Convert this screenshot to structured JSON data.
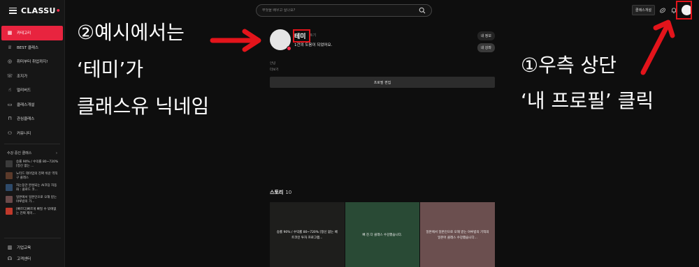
{
  "sidebar": {
    "logo": "CLASSU",
    "logo_dot": "•",
    "nav": [
      {
        "label": "카테고리",
        "icon": "category-icon"
      },
      {
        "label": "BEST 클래스",
        "icon": "trophy-icon"
      },
      {
        "label": "취미부터 취업까지!",
        "icon": "target-icon"
      },
      {
        "label": "조지가",
        "icon": "phone-icon"
      },
      {
        "label": "얼리버드",
        "icon": "thumbs-up-icon"
      },
      {
        "label": "클래스개설",
        "icon": "video-icon"
      },
      {
        "label": "관심클래스",
        "icon": "bookmark-icon"
      },
      {
        "label": "커뮤니티",
        "icon": "people-icon"
      }
    ],
    "section_title": "수강 중인 클래스",
    "section_chevron": "›",
    "courses": [
      {
        "title": "승률 90% / 수익률 80~720% [정신 없는 ...",
        "color": "#3a3a3a"
      },
      {
        "title": "노터드 데이엄의 진짜 쉬운 역직구 클래스",
        "color": "#5b3a2a"
      },
      {
        "title": "자는동안 완성되는 AI코딩 자동화 : 클로드 코...",
        "color": "#2e4a6a"
      },
      {
        "title": "일본에서 일본인으로 오해 받는 야루밤의 가...",
        "color": "#6a4a4a"
      },
      {
        "title": "[빠르디]빠르게 빠질 수 밖에없는 진짜 제미...",
        "color": "#c0392b"
      }
    ],
    "footer": [
      {
        "label": "기업교육",
        "icon": "building-icon"
      },
      {
        "label": "고객센터",
        "icon": "headset-icon"
      }
    ]
  },
  "header": {
    "search_placeholder": "무엇을 배우고 싶나요?",
    "open_class_label": "클래스개설"
  },
  "profile": {
    "nickname": "테미",
    "nick_suffix": "트기",
    "status": "1건의 도움이 되었어요.",
    "btn_info": "내 정보",
    "btn_class": "내 강좌",
    "intro_label": "안녕",
    "intro_more": "더보기",
    "edit_label": "프로필 편집"
  },
  "stories": {
    "title": "스토리",
    "count": "10",
    "items": [
      {
        "text": "승률 90% / 수익률 80~720% [정신 없는 베트코인 투자 프로그램...",
        "color": "#1e1e1c"
      },
      {
        "text": "빠.진.다 클래스 수강했습니다.",
        "color": "#294a35"
      },
      {
        "text": "일본에서 일본인으로 오해 받는 야루밤의 기적의 일본어 클래스 수강했습니다...",
        "color": "#6b4f4f"
      }
    ]
  },
  "annotations": {
    "left_line1": "②예시에서는",
    "left_line2": "‘테미’가",
    "left_line3": "클래스유 닉네임",
    "right_line1": "①우측 상단",
    "right_line2": "‘내 프로필’ 클릭"
  },
  "colors": {
    "accent": "#e8243f",
    "highlight": "#e3141b"
  }
}
